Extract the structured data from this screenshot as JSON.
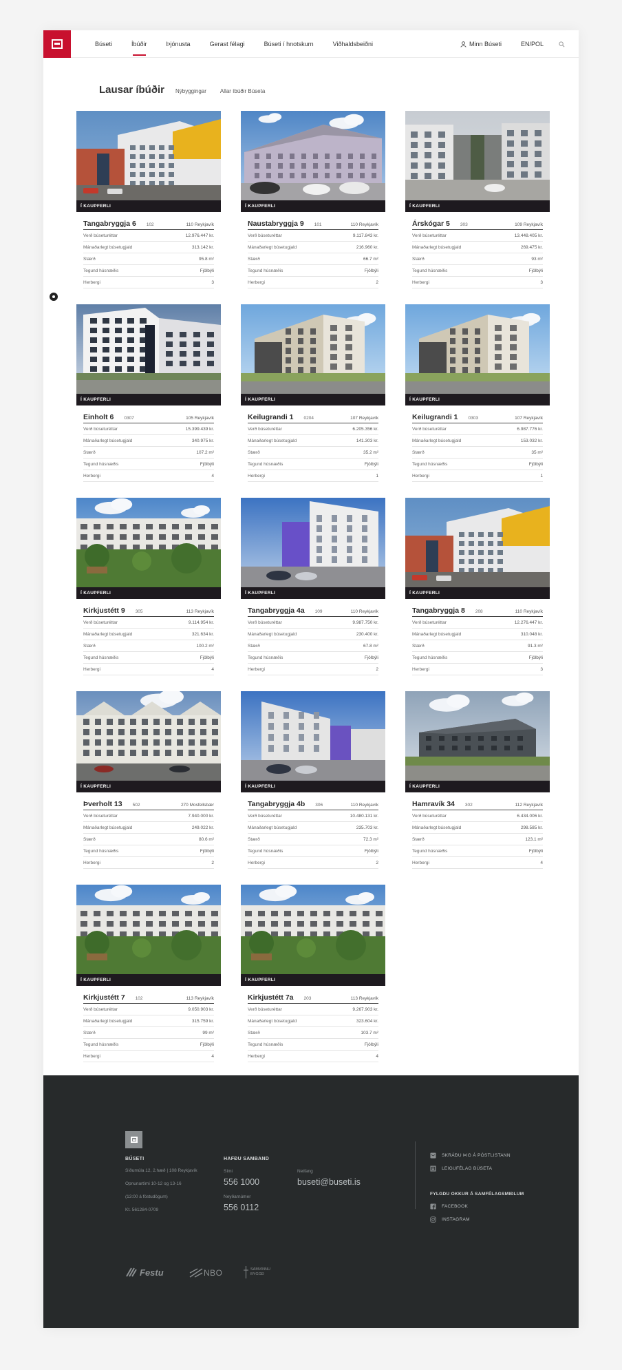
{
  "nav": {
    "items": [
      "Búseti",
      "Íbúðir",
      "Þjónusta",
      "Gerast félagi",
      "Búseti í hnotskurn",
      "Viðhaldsbeiðni"
    ],
    "active_index": 1,
    "user_label": "Minn Búseti",
    "lang_label": "EN/POL"
  },
  "page": {
    "title": "Lausar íbúðir",
    "subnav": [
      "Nýbyggingar",
      "Allar íbúðir Búseta"
    ]
  },
  "labels": {
    "badge": "Í KAUPFERLI",
    "price": "Verð búseturéttar",
    "fee": "Mánaðarlegt búsetugjald",
    "size": "Stærð",
    "type": "Tegund húsnæðis",
    "rooms": "Herbergi"
  },
  "listings": [
    {
      "address": "Tangabryggja 6",
      "unit": "102",
      "city": "110 Reykjavík",
      "price": "12.976.447 kr.",
      "fee": "313.142 kr.",
      "size": "95.8 m²",
      "type": "Fjölbýli",
      "rooms": "3",
      "photo": "yellow"
    },
    {
      "address": "Naustabryggja 9",
      "unit": "101",
      "city": "110 Reykjavík",
      "price": "9.117.843 kr.",
      "fee": "216.960 kr.",
      "size": "66.7 m²",
      "type": "Fjölbýli",
      "rooms": "2",
      "photo": "lilac"
    },
    {
      "address": "Árskógar 5",
      "unit": "303",
      "city": "109 Reykjavík",
      "price": "13.448.405 kr.",
      "fee": "269.475 kr.",
      "size": "93 m²",
      "type": "Fjölbýli",
      "rooms": "3",
      "photo": "courtyard"
    },
    {
      "address": "Einholt 6",
      "unit": "0307",
      "city": "105 Reykjavík",
      "price": "15.399.439 kr.",
      "fee": "340.975 kr.",
      "size": "107.2 m²",
      "type": "Fjölbýli",
      "rooms": "4",
      "photo": "white"
    },
    {
      "address": "Keilugrandi 1",
      "unit": "0204",
      "city": "107 Reykjavík",
      "price": "6.205.356 kr.",
      "fee": "141.303 kr.",
      "size": "35.2 m²",
      "type": "Fjölbýli",
      "rooms": "1",
      "photo": "beige"
    },
    {
      "address": "Keilugrandi 1",
      "unit": "0303",
      "city": "107 Reykjavík",
      "price": "6.987.776 kr.",
      "fee": "153.032 kr.",
      "size": "35 m²",
      "type": "Fjölbýli",
      "rooms": "1",
      "photo": "beige"
    },
    {
      "address": "Kirkjustétt 9",
      "unit": "305",
      "city": "113 Reykjavík",
      "price": "9.114.954 kr.",
      "fee": "321.634 kr.",
      "size": "100.2 m²",
      "type": "Fjölbýli",
      "rooms": "4",
      "photo": "garden"
    },
    {
      "address": "Tangabryggja 4a",
      "unit": "109",
      "city": "110 Reykjavík",
      "price": "9.987.750 kr.",
      "fee": "230.400 kr.",
      "size": "67.8 m²",
      "type": "Fjölbýli",
      "rooms": "2",
      "photo": "purple"
    },
    {
      "address": "Tangabryggja 8",
      "unit": "208",
      "city": "110 Reykjavík",
      "price": "12.276.447 kr.",
      "fee": "310.048 kr.",
      "size": "91.3 m²",
      "type": "Fjölbýli",
      "rooms": "3",
      "photo": "yellow"
    },
    {
      "address": "Þverholt 13",
      "unit": "502",
      "city": "270 Mosfellsbær",
      "price": "7.940.000 kr.",
      "fee": "249.022 kr.",
      "size": "80.6 m²",
      "type": "Fjölbýli",
      "rooms": "2",
      "photo": "row"
    },
    {
      "address": "Tangabryggja 4b",
      "unit": "306",
      "city": "110 Reykjavík",
      "price": "10.480.131 kr.",
      "fee": "235.703 kr.",
      "size": "72.3 m²",
      "type": "Fjölbýli",
      "rooms": "2",
      "photo": "purple2"
    },
    {
      "address": "Hamravík 34",
      "unit": "302",
      "city": "112 Reykjavík",
      "price": "6.434.006 kr.",
      "fee": "298.585 kr.",
      "size": "123.1 m²",
      "type": "Fjölbýli",
      "rooms": "4",
      "photo": "grey"
    },
    {
      "address": "Kirkjustétt 7",
      "unit": "102",
      "city": "113 Reykjavík",
      "price": "9.050.903 kr.",
      "fee": "315.759 kr.",
      "size": "99 m²",
      "type": "Fjölbýli",
      "rooms": "4",
      "photo": "garden"
    },
    {
      "address": "Kirkjustétt 7a",
      "unit": "203",
      "city": "113 Reykjavík",
      "price": "9.267.903 kr.",
      "fee": "323.604 kr.",
      "size": "103.7 m²",
      "type": "Fjölbýli",
      "rooms": "4",
      "photo": "garden"
    }
  ],
  "footer": {
    "company_heading": "BÚSETI",
    "address": "Síðumúla 12, 2.hæð | 108 Reykjavík",
    "hours": "Opnunartími 10-12 og 13-16",
    "hours_note": "(13:00 á föstudögum)",
    "kt": "Kt. 561284-0709",
    "contact_heading": "HAFÐU SAMBAND",
    "phone_label": "Sími",
    "phone": "556 1000",
    "email_label": "Netfang",
    "email": "buseti@buseti.is",
    "emergency_label": "Neyðarnúmer",
    "emergency": "556 0112",
    "links": [
      "SKRÁÐU ÞIG Á PÓSTLISTANN",
      "LEIGUFÉLAG BÚSETA"
    ],
    "social_heading": "FYLGDU OKKUR Á SAMFÉLAGSMIÐLUM",
    "social": [
      "FACEBOOK",
      "INSTAGRAM"
    ],
    "partners": [
      "Festu",
      "NBO",
      "SAMVINNU BYGGÐ"
    ]
  },
  "colors": {
    "brand_red": "#c8102e",
    "badge_bg": "#1e1a1f",
    "footer_bg": "#272a2b"
  }
}
